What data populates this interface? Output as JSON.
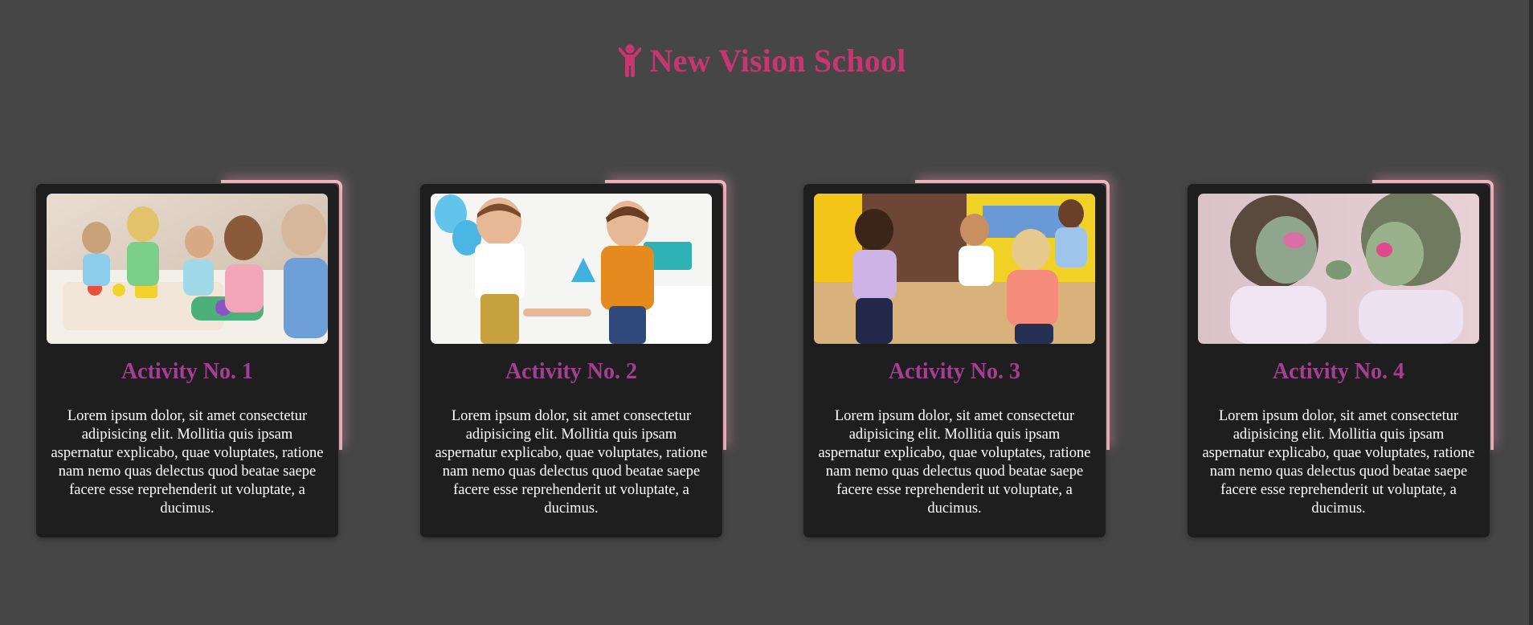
{
  "header": {
    "title": "New Vision School",
    "logo_icon": "child-icon",
    "accent_color": "#c7366f"
  },
  "colors": {
    "background": "#464646",
    "card_background": "#1f1e1f",
    "card_title": "#a43f93",
    "glow": "#f7b6c6"
  },
  "cards": [
    {
      "title": "Activity No. 1",
      "image": "children-playing-with-toys-photo",
      "text": "Lorem ipsum dolor, sit amet consectetur adipisicing elit. Mollitia quis ipsam aspernatur explicabo, quae voluptates, ratione nam nemo quas delectus quod beatae saepe facere esse reprehenderit ut voluptate, a ducimus."
    },
    {
      "title": "Activity No. 2",
      "image": "children-shaking-hands-photo",
      "text": "Lorem ipsum dolor, sit amet consectetur adipisicing elit. Mollitia quis ipsam aspernatur explicabo, quae voluptates, ratione nam nemo quas delectus quod beatae saepe facere esse reprehenderit ut voluptate, a ducimus."
    },
    {
      "title": "Activity No. 3",
      "image": "children-dancing-photo",
      "text": "Lorem ipsum dolor, sit amet consectetur adipisicing elit. Mollitia quis ipsam aspernatur explicabo, quae voluptates, ratione nam nemo quas delectus quod beatae saepe facere esse reprehenderit ut voluptate, a ducimus."
    },
    {
      "title": "Activity No. 4",
      "image": "children-with-color-powder-photo",
      "text": "Lorem ipsum dolor, sit amet consectetur adipisicing elit. Mollitia quis ipsam aspernatur explicabo, quae voluptates, ratione nam nemo quas delectus quod beatae saepe facere esse reprehenderit ut voluptate, a ducimus."
    }
  ]
}
